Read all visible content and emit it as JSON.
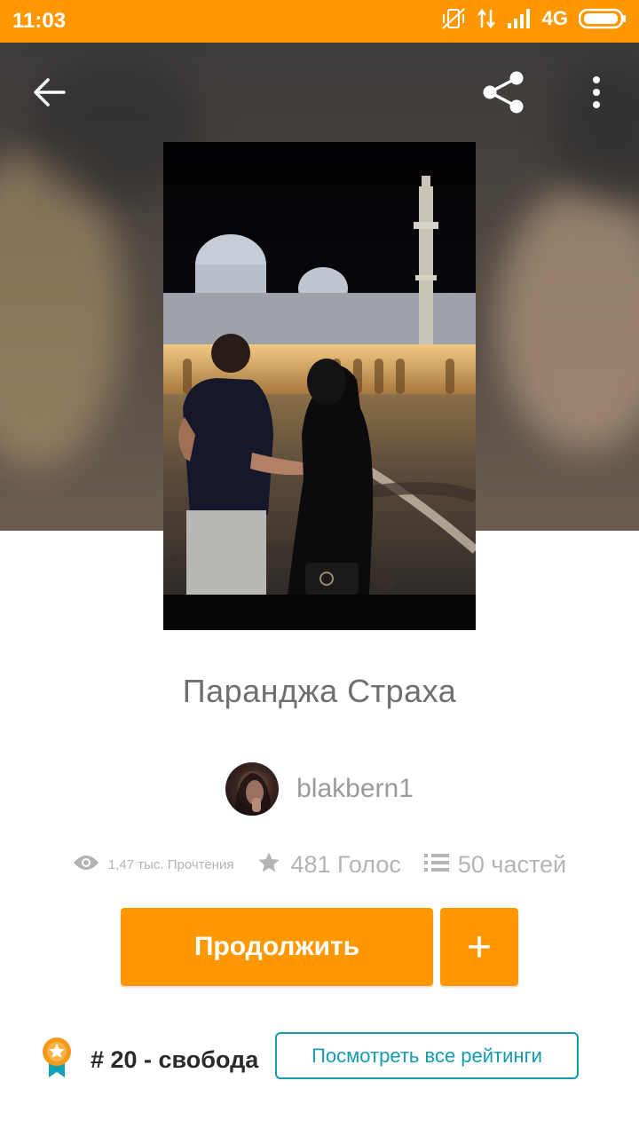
{
  "status_bar": {
    "time": "11:03",
    "network": "4G",
    "icons": [
      "vibrate-icon",
      "data-arrows-icon",
      "signal-icon",
      "battery-icon"
    ]
  },
  "toolbar": {
    "icons": [
      "back-arrow-icon",
      "share-icon",
      "more-vert-icon"
    ]
  },
  "story": {
    "title": "Паранджа Страха",
    "author": "blakbern1"
  },
  "stats": {
    "reads": "1,47 тыс. Прочтения",
    "votes": "481 Голос",
    "parts": "50 частей"
  },
  "actions": {
    "continue_label": "Продолжить",
    "add_label": "+"
  },
  "ranking": {
    "label": "# 20 - свобода",
    "view_all_label": "Посмотреть все рейтинги"
  },
  "colors": {
    "accent": "#ff9800",
    "teal": "#139bb0",
    "muted_text": "#b4b4b4"
  }
}
